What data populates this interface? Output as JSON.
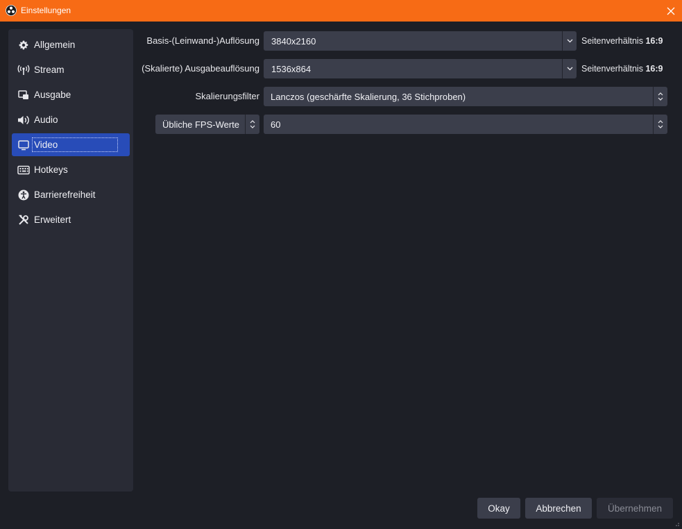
{
  "window": {
    "title": "Einstellungen",
    "titlebar_color": "#f76b15"
  },
  "sidebar": {
    "items": [
      {
        "label": "Allgemein",
        "icon": "gear-icon"
      },
      {
        "label": "Stream",
        "icon": "antenna-icon"
      },
      {
        "label": "Ausgabe",
        "icon": "output-icon"
      },
      {
        "label": "Audio",
        "icon": "speaker-icon"
      },
      {
        "label": "Video",
        "icon": "monitor-icon",
        "active": true
      },
      {
        "label": "Hotkeys",
        "icon": "keyboard-icon"
      },
      {
        "label": "Barrierefreiheit",
        "icon": "accessibility-icon"
      },
      {
        "label": "Erweitert",
        "icon": "tools-icon"
      }
    ],
    "active_color": "#284cb8"
  },
  "video": {
    "base_resolution": {
      "label": "Basis-(Leinwand-)Auflösung",
      "value": "3840x2160",
      "aspect_prefix": "Seitenverhältnis",
      "aspect_value": "16:9"
    },
    "output_resolution": {
      "label": "(Skalierte) Ausgabeauflösung",
      "value": "1536x864",
      "aspect_prefix": "Seitenverhältnis",
      "aspect_value": "16:9"
    },
    "scale_filter": {
      "label": "Skalierungsfilter",
      "value": "Lanczos (geschärfte Skalierung, 36 Stichproben)"
    },
    "fps": {
      "type_value": "Übliche FPS-Werte",
      "value": "60"
    }
  },
  "buttons": {
    "ok": "Okay",
    "cancel": "Abbrechen",
    "apply": "Übernehmen"
  }
}
